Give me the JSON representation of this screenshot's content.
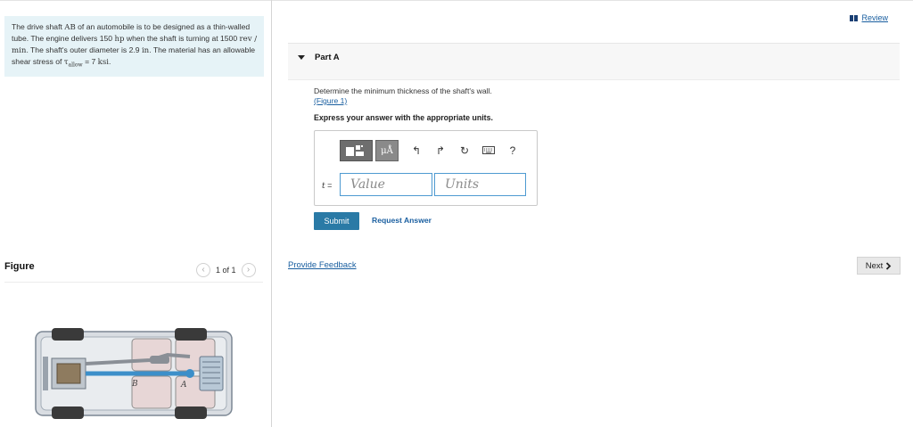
{
  "problem": {
    "segments": [
      {
        "text": "The drive shaft ",
        "math": false
      },
      {
        "text": "AB",
        "math": true
      },
      {
        "text": " of an automobile is to be designed as a thin-walled tube. The engine delivers 150 ",
        "math": false
      },
      {
        "text": "hp",
        "math": true
      },
      {
        "text": " when the shaft is turning at 1500 ",
        "math": false
      },
      {
        "text": "rev / min",
        "math": true
      },
      {
        "text": ". The shaft's outer diameter is 2.9 ",
        "math": false
      },
      {
        "text": "in",
        "math": true
      },
      {
        "text": ". The material has an allowable shear stress of ",
        "math": false
      },
      {
        "text": "τ",
        "math": true
      },
      {
        "text": "allow",
        "math": true,
        "sub": true
      },
      {
        "text": " = 7 ",
        "math": false
      },
      {
        "text": "ksi",
        "math": true
      },
      {
        "text": ".",
        "math": false
      }
    ]
  },
  "figure": {
    "title": "Figure",
    "pager": "1 of 1",
    "prev_icon": "chevron-left-icon",
    "next_icon": "chevron-right-icon",
    "labels": {
      "a": "A",
      "b": "B"
    }
  },
  "header": {
    "review_label": "Review"
  },
  "part": {
    "title": "Part A"
  },
  "question": {
    "text": "Determine the minimum thickness of the shaft's wall.",
    "figure_link": "(Figure 1)"
  },
  "instruction": "Express your answer with the appropriate units.",
  "answer": {
    "label": "t",
    "equals": " =",
    "value_placeholder": "Value",
    "units_placeholder": "Units",
    "toolbar": {
      "templates_icon": "templates-icon",
      "units_button": "μÅ",
      "undo": "↰",
      "redo": "↱",
      "reset": "↻",
      "keyboard_icon": "keyboard-icon",
      "help": "?"
    }
  },
  "actions": {
    "submit": "Submit",
    "request_answer": "Request Answer",
    "provide_feedback": "Provide Feedback",
    "next": "Next"
  },
  "colors": {
    "accent": "#2a7aa6",
    "link": "#1a5fa0",
    "problem_bg": "#e6f3f7",
    "input_border": "#4e9ad1"
  }
}
